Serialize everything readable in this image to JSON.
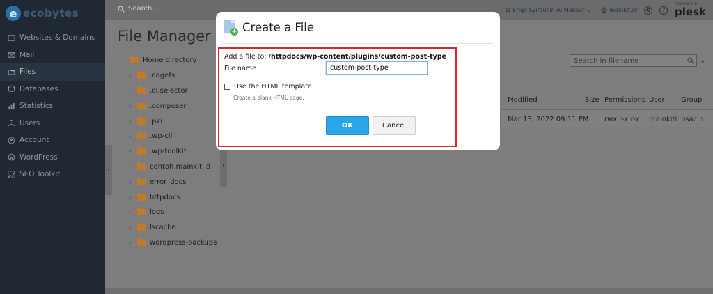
{
  "brand": {
    "logo_letter": "e",
    "logo_text": "ecobytes"
  },
  "sidebar": {
    "items": [
      {
        "label": "Websites & Domains",
        "icon": "globe-icon"
      },
      {
        "label": "Mail",
        "icon": "mail-icon"
      },
      {
        "label": "Files",
        "icon": "folder-icon",
        "active": true
      },
      {
        "label": "Databases",
        "icon": "database-icon"
      },
      {
        "label": "Statistics",
        "icon": "chart-icon"
      },
      {
        "label": "Users",
        "icon": "user-icon"
      },
      {
        "label": "Account",
        "icon": "account-icon"
      },
      {
        "label": "WordPress",
        "icon": "wordpress-icon"
      },
      {
        "label": "SEO Toolkit",
        "icon": "seo-icon"
      }
    ]
  },
  "topbar": {
    "search_placeholder": "Search...",
    "user_name": "Eriga Syifaudin Al-Mansur",
    "site_name": "mainkit.id",
    "plesk_powered": "POWERED BY",
    "plesk_name": "plesk"
  },
  "main": {
    "title": "File Manager",
    "tree": [
      {
        "label": "Home directory",
        "chevron": ""
      },
      {
        "label": ".cagefs",
        "chevron": "›"
      },
      {
        "label": ".cl.selector",
        "chevron": "›"
      },
      {
        "label": ".composer",
        "chevron": "›"
      },
      {
        "label": ".pki",
        "chevron": "›"
      },
      {
        "label": ".wp-cli",
        "chevron": "›"
      },
      {
        "label": ".wp-toolkit",
        "chevron": "›"
      },
      {
        "label": "contoh.mainkit.id",
        "chevron": "›"
      },
      {
        "label": "error_docs",
        "chevron": "›"
      },
      {
        "label": "httpdocs",
        "chevron": "›"
      },
      {
        "label": "logs",
        "chevron": "›"
      },
      {
        "label": "lscache",
        "chevron": "›"
      },
      {
        "label": "wordpress-backups",
        "chevron": "›"
      }
    ],
    "file_search_placeholder": "Search in filename",
    "columns": {
      "modified": "Modified",
      "size": "Size",
      "permissions": "Permissions",
      "user": "User",
      "group": "Group"
    },
    "row": {
      "modified": "Mar 13, 2022 09:11 PM",
      "permissions": "rwx r-x r-x",
      "user": "mainkiti",
      "group": "psacln"
    }
  },
  "modal": {
    "title": "Create a File",
    "add_prefix": "Add a file to: ",
    "add_path": "/httpdocs/wp-content/plugins/custom-post-type",
    "file_name_label": "File name",
    "file_name_value": "custom-post-type",
    "template_label": "Use the HTML template",
    "template_hint": "Create a blank HTML page.",
    "ok_label": "OK",
    "cancel_label": "Cancel"
  },
  "colors": {
    "highlight": "#d9262b",
    "ok_button": "#2aa5e6",
    "folder": "#c07a2a"
  }
}
